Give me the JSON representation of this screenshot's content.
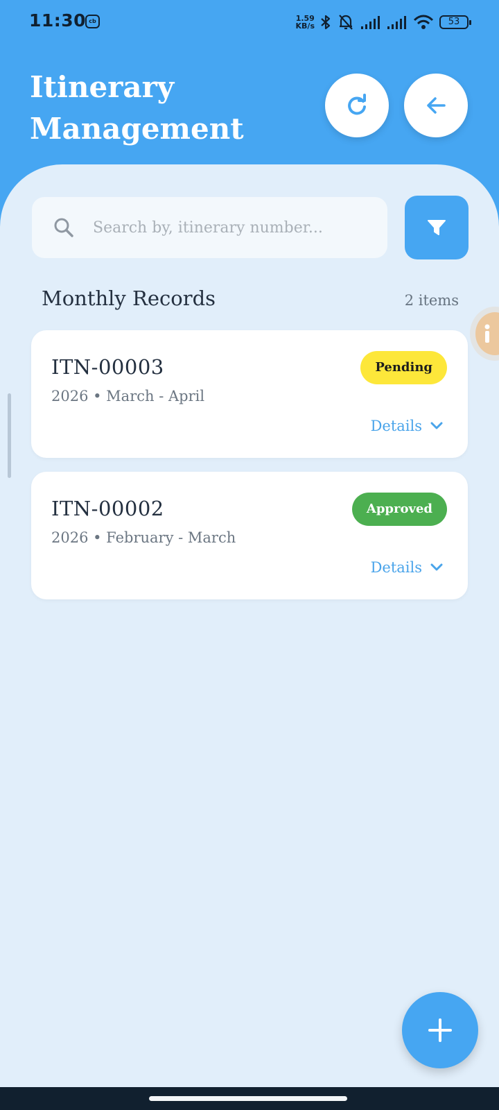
{
  "status_bar": {
    "time": "11:30",
    "app_icon_label": "cb",
    "net_speed_value": "1.59",
    "net_speed_unit": "KB/s",
    "battery": "53"
  },
  "header": {
    "title": "Itinerary\nManagement",
    "refresh_icon": "refresh-icon",
    "back_icon": "arrow-left-icon"
  },
  "search": {
    "placeholder": "Search by, itinerary number...",
    "value": ""
  },
  "section": {
    "title": "Monthly Records",
    "count": "2 items"
  },
  "records": [
    {
      "id": "ITN-00003",
      "subtitle": "2026 • March - April",
      "status": "Pending",
      "details_label": "Details"
    },
    {
      "id": "ITN-00002",
      "subtitle": "2026 • February - March",
      "status": "Approved",
      "details_label": "Details"
    }
  ],
  "colors": {
    "primary": "#46a6f2",
    "background": "#e1eefa",
    "pending": "#fde73a",
    "approved": "#4caf50"
  }
}
